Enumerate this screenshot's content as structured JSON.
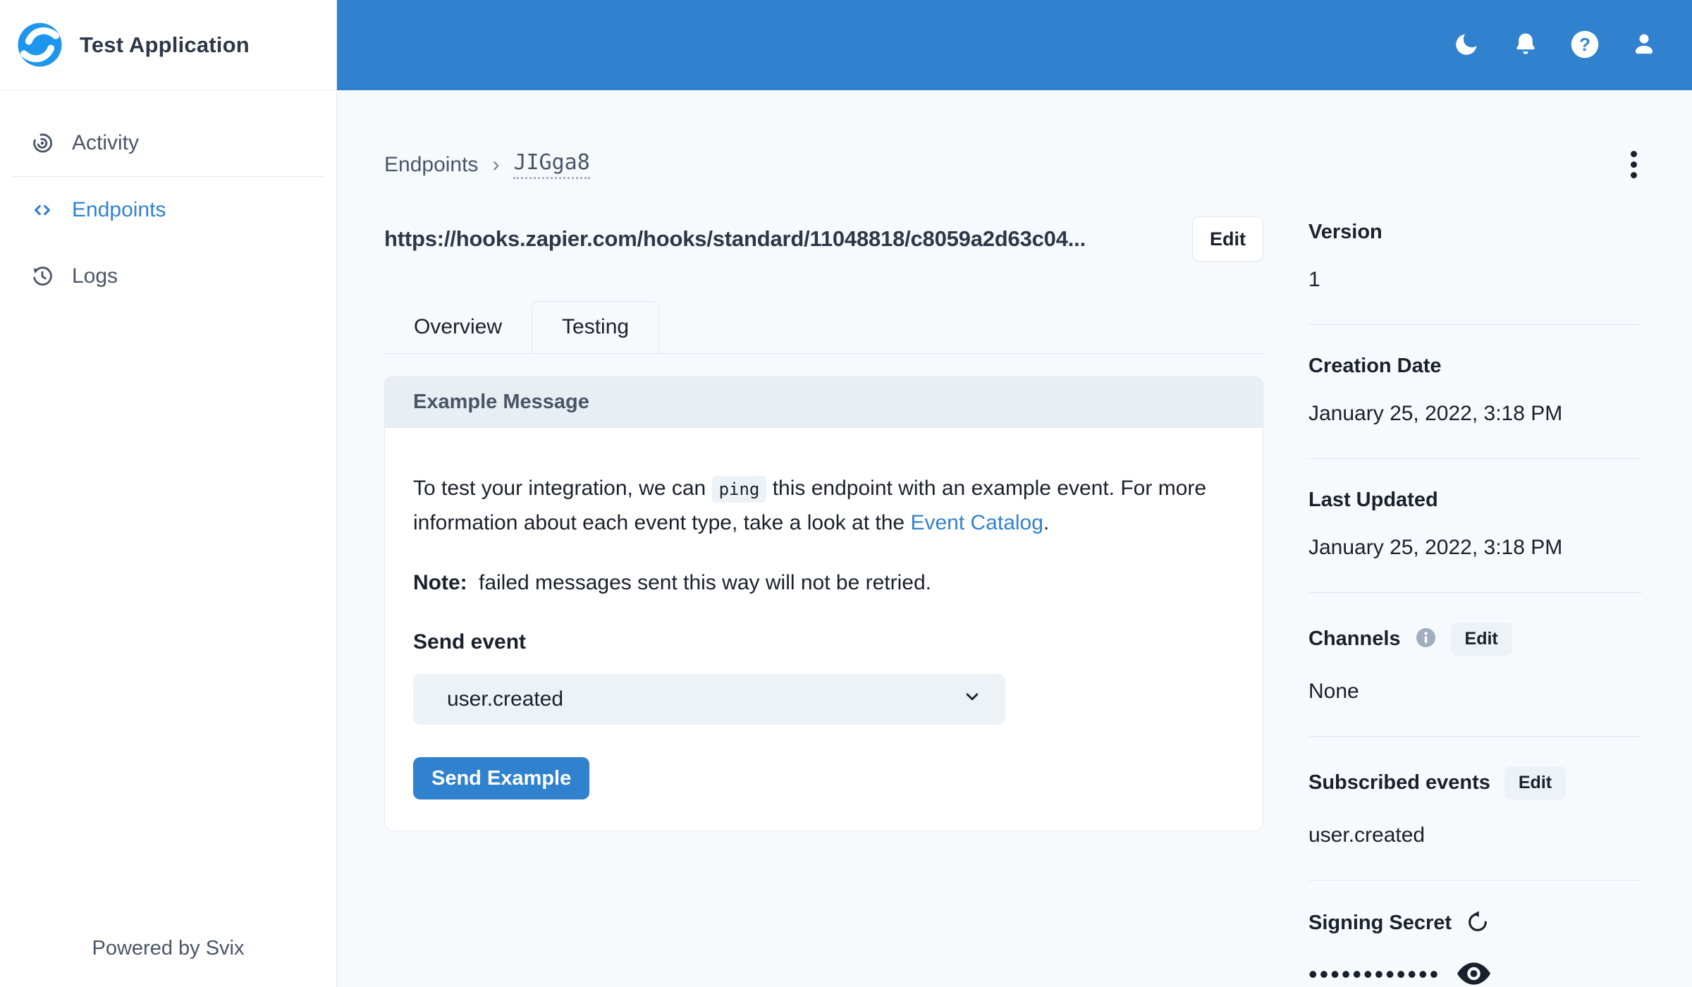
{
  "app": {
    "title": "Test Application",
    "powered_by": "Powered by Svix"
  },
  "colors": {
    "accent": "#3182CE",
    "topbar": "#3182CE",
    "logo_blue": "#1E96EE",
    "page_bg": "#F7FAFC",
    "border": "#E2E8F0",
    "chip_bg": "#EDF2F7",
    "text": "#1A202C",
    "muted_text": "#4A5568"
  },
  "topbar": {
    "icons": [
      {
        "name": "moon-icon"
      },
      {
        "name": "bell-icon"
      },
      {
        "name": "help-icon"
      },
      {
        "name": "account-icon"
      }
    ]
  },
  "sidebar": {
    "items": [
      {
        "label": "Activity",
        "icon": "activity-icon",
        "active": false
      },
      {
        "label": "Endpoints",
        "icon": "endpoints-code-icon",
        "active": true
      },
      {
        "label": "Logs",
        "icon": "logs-history-icon",
        "active": false
      }
    ]
  },
  "breadcrumb": {
    "parent": "Endpoints",
    "separator": "›",
    "current": "JIGga8"
  },
  "endpoint": {
    "url": "https://hooks.zapier.com/hooks/standard/11048818/c8059a2d63c04...",
    "edit_label": "Edit"
  },
  "tabs": [
    {
      "label": "Overview",
      "active": false
    },
    {
      "label": "Testing",
      "active": true
    }
  ],
  "example_message": {
    "title": "Example Message",
    "intro_part1": "To test your integration, we can",
    "code_text": "ping",
    "intro_part2": "this endpoint with an example event. For more information about each event type, take a look at the",
    "link_text": "Event Catalog",
    "intro_part3": ".",
    "note_label": "Note:",
    "note_text": "failed messages sent this way will not be retried.",
    "send_event_label": "Send event",
    "selected_event": "user.created",
    "send_button_label": "Send Example"
  },
  "details": {
    "version": {
      "label": "Version",
      "value": "1"
    },
    "creation_date": {
      "label": "Creation Date",
      "value": "January 25, 2022, 3:18 PM"
    },
    "last_updated": {
      "label": "Last Updated",
      "value": "January 25, 2022, 3:18 PM"
    },
    "channels": {
      "label": "Channels",
      "value": "None",
      "edit_label": "Edit",
      "info_icon": "info-icon"
    },
    "subscribed_events": {
      "label": "Subscribed events",
      "value": "user.created",
      "edit_label": "Edit"
    },
    "signing_secret": {
      "label": "Signing Secret",
      "masked_value": "••••••••••••",
      "refresh_icon": "rotate-secret-icon",
      "reveal_icon": "eye-icon"
    }
  },
  "menu": {
    "kebab_icon": "kebab-menu-icon"
  }
}
